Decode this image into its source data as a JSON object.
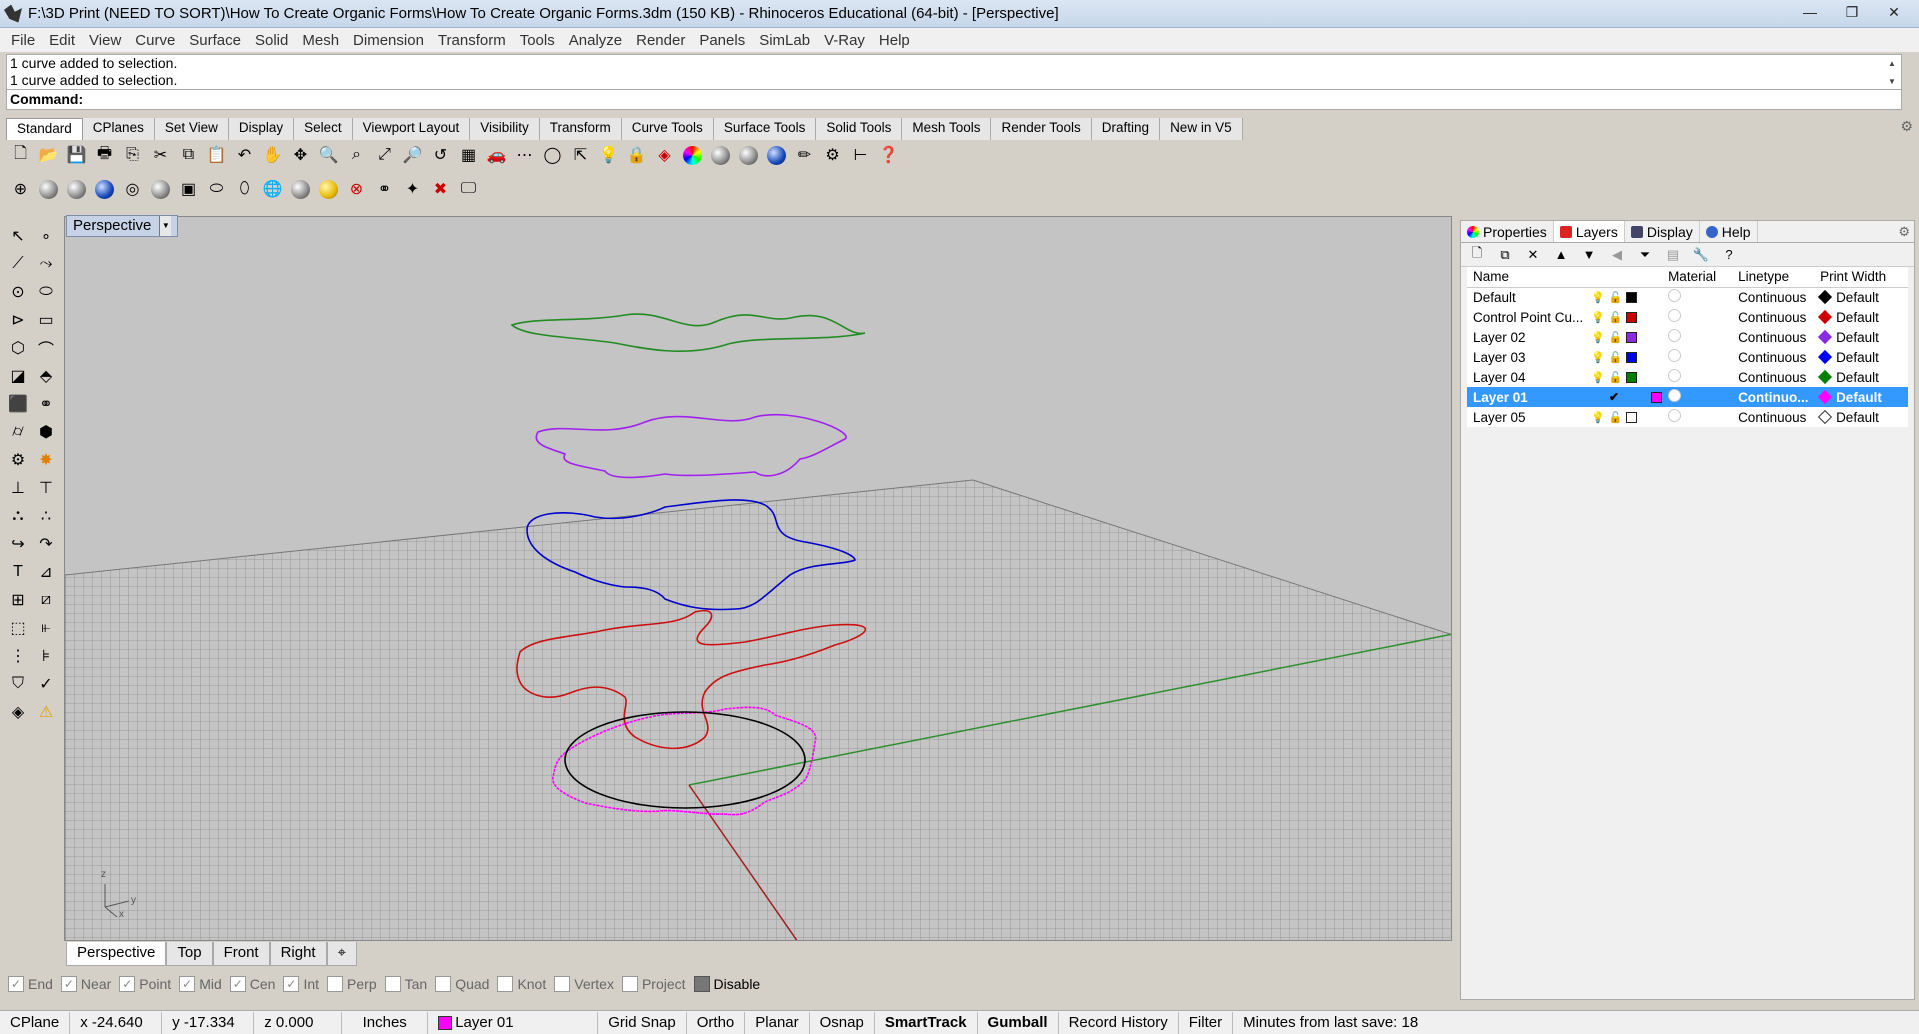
{
  "window": {
    "title": "F:\\3D Print (NEED TO SORT)\\How To Create Organic Forms\\How To Create Organic Forms.3dm (150 KB) - Rhinoceros Educational (64-bit) - [Perspective]",
    "minimize": "—",
    "restore": "❐",
    "close": "✕"
  },
  "menu": [
    "File",
    "Edit",
    "View",
    "Curve",
    "Surface",
    "Solid",
    "Mesh",
    "Dimension",
    "Transform",
    "Tools",
    "Analyze",
    "Render",
    "Panels",
    "SimLab",
    "V-Ray",
    "Help"
  ],
  "command": {
    "history": [
      "1 curve added to selection.",
      "1 curve added to selection."
    ],
    "prompt": "Command:"
  },
  "toolbar_tabs": [
    "Standard",
    "CPlanes",
    "Set View",
    "Display",
    "Select",
    "Viewport Layout",
    "Visibility",
    "Transform",
    "Curve Tools",
    "Surface Tools",
    "Solid Tools",
    "Mesh Tools",
    "Render Tools",
    "Drafting",
    "New in V5"
  ],
  "viewport": {
    "label": "Perspective",
    "axis_x": "x",
    "axis_y": "y",
    "axis_z": "z"
  },
  "viewport_tabs": [
    "Perspective",
    "Top",
    "Front",
    "Right",
    "⌖"
  ],
  "osnaps": [
    {
      "label": "End",
      "checked": true
    },
    {
      "label": "Near",
      "checked": true
    },
    {
      "label": "Point",
      "checked": true
    },
    {
      "label": "Mid",
      "checked": true
    },
    {
      "label": "Cen",
      "checked": true
    },
    {
      "label": "Int",
      "checked": true
    },
    {
      "label": "Perp",
      "checked": false
    },
    {
      "label": "Tan",
      "checked": false
    },
    {
      "label": "Quad",
      "checked": false
    },
    {
      "label": "Knot",
      "checked": false
    },
    {
      "label": "Vertex",
      "checked": false
    },
    {
      "label": "Project",
      "checked": false
    },
    {
      "label": "Disable",
      "checked": false
    }
  ],
  "status": {
    "cplane": "CPlane",
    "x": "x -24.640",
    "y": "y -17.334",
    "z": "z 0.000",
    "units": "Inches",
    "layer": "Layer 01",
    "layer_color": "#ff00ff",
    "grid_snap": "Grid Snap",
    "ortho": "Ortho",
    "planar": "Planar",
    "osnap": "Osnap",
    "smarttrack": "SmartTrack",
    "gumball": "Gumball",
    "record_history": "Record History",
    "filter": "Filter",
    "save_info": "Minutes from last save: 18"
  },
  "panel": {
    "tabs": [
      "Properties",
      "Layers",
      "Display",
      "Help"
    ],
    "columns": {
      "name": "Name",
      "material": "Material",
      "linetype": "Linetype",
      "print_width": "Print Width"
    },
    "layers": [
      {
        "name": "Default",
        "color": "#000000",
        "linetype": "Continuous",
        "print_width": "Default"
      },
      {
        "name": "Control Point Cu...",
        "color": "#cc0000",
        "linetype": "Continuous",
        "print_width": "Default"
      },
      {
        "name": "Layer 02",
        "color": "#8a2be2",
        "linetype": "Continuous",
        "print_width": "Default"
      },
      {
        "name": "Layer 03",
        "color": "#0000ee",
        "linetype": "Continuous",
        "print_width": "Default"
      },
      {
        "name": "Layer 04",
        "color": "#008000",
        "linetype": "Continuous",
        "print_width": "Default"
      },
      {
        "name": "Layer 01",
        "color": "#ff00ff",
        "linetype": "Continuo...",
        "print_width": "Default",
        "current": true
      },
      {
        "name": "Layer 05",
        "color": "#ffffff",
        "linetype": "Continuous",
        "print_width": "Default"
      }
    ]
  },
  "colors": {
    "curve_green": "#228b22",
    "curve_purple": "#a020f0",
    "curve_blue": "#0000cd",
    "curve_red": "#cc1010",
    "curve_magenta": "#ff00ff",
    "curve_black": "#000000",
    "selection": "#3399ff"
  }
}
